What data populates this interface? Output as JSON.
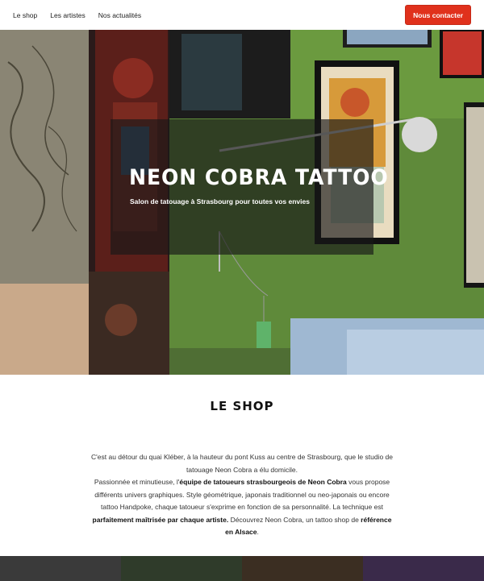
{
  "nav": {
    "links": [
      "Le shop",
      "Les artistes",
      "Nos actualités"
    ],
    "cta_label": "Nous contacter"
  },
  "hero": {
    "title": "Neon Cobra Tattoo",
    "subtitle": "Salon de tatouage à Strasbourg pour toutes vos envies"
  },
  "shop": {
    "title": "Le shop",
    "p1": "C'est au détour du quai Kléber, à la hauteur du pont Kuss au centre de Strasbourg, que le studio de tatouage Neon Cobra a élu domicile.",
    "p2_a": "Passionnée et minutieuse, l'",
    "p2_b": "équipe de tatoueurs strasbourgeois de Neon Cobra",
    "p2_c": " vous propose différents univers graphiques. Style géométrique, japonais traditionnel ou neo-japonais ou encore tattoo Handpoke, chaque tatoueur s'exprime en fonction de sa personnalité. La technique est ",
    "p2_d": "parfaitement maîtrisée par chaque artiste.",
    "p2_e": " Découvrez Neon Cobra, un tattoo shop de ",
    "p2_f": "référence en Alsace",
    "p2_g": "."
  },
  "colors": {
    "accent": "#e0311c",
    "wall_green": "#5f8a3a"
  }
}
